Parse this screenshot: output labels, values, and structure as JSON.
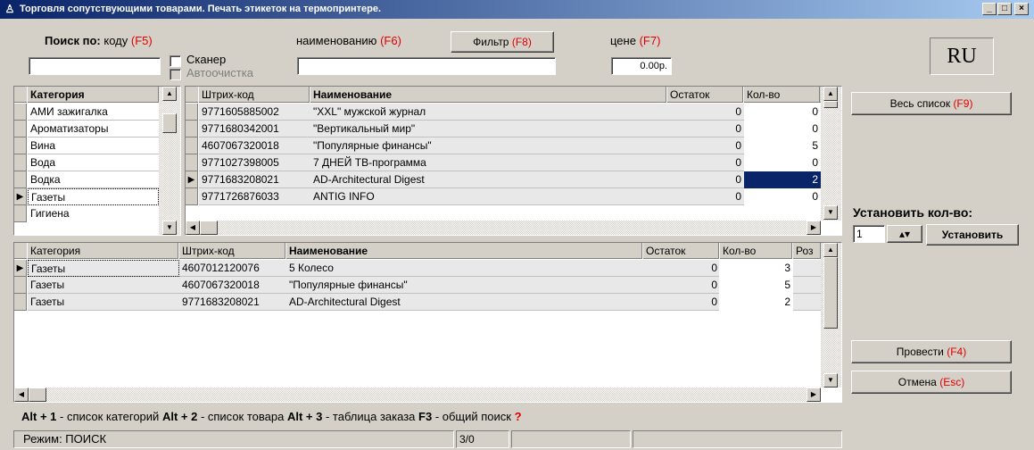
{
  "window": {
    "title": "Торговля сопутствующими товарами. Печать этикеток на термопринтере."
  },
  "search": {
    "label_bold": "Поиск по:",
    "by_code": "коду",
    "f5": "(F5)",
    "scanner_label": "Сканер",
    "autoclean_label": "Автоочистка",
    "by_name": "наименованию",
    "f6": "(F6)",
    "filter_button": "Фильтр",
    "f8": "(F8)",
    "by_price": "цене",
    "f7": "(F7)",
    "price_value": "0.00р.",
    "code_value": "",
    "name_value": ""
  },
  "lang": "RU",
  "categories": {
    "header": "Категория",
    "items": [
      "АМИ зажигалка",
      "Ароматизаторы",
      "Вина",
      "Вода",
      "Водка",
      "Газеты",
      "Гигиена"
    ],
    "selected": "Газеты"
  },
  "products": {
    "headers": {
      "barcode": "Штрих-код",
      "name": "Наименование",
      "stock": "Остаток",
      "qty": "Кол-во"
    },
    "rows": [
      {
        "barcode": "9771605885002",
        "name": "\"XXL\" мужской журнал",
        "stock": "0",
        "qty": "0"
      },
      {
        "barcode": "9771680342001",
        "name": "\"Вертикальный мир\"",
        "stock": "0",
        "qty": "0"
      },
      {
        "barcode": "4607067320018",
        "name": "\"Популярные финансы\"",
        "stock": "0",
        "qty": "5"
      },
      {
        "barcode": "9771027398005",
        "name": "7 ДНЕЙ ТВ-программа",
        "stock": "0",
        "qty": "0"
      },
      {
        "barcode": "9771683208021",
        "name": "AD-Architectural Digest",
        "stock": "0",
        "qty": "2"
      },
      {
        "barcode": "9771726876033",
        "name": "ANTIG INFO",
        "stock": "0",
        "qty": "0"
      }
    ]
  },
  "order": {
    "headers": {
      "category": "Категория",
      "barcode": "Штрих-код",
      "name": "Наименование",
      "stock": "Остаток",
      "qty": "Кол-во",
      "pos": "Роз"
    },
    "rows": [
      {
        "category": "Газеты",
        "barcode": "4607012120076",
        "name": "5 Колесо",
        "stock": "0",
        "qty": "3"
      },
      {
        "category": "Газеты",
        "barcode": "4607067320018",
        "name": "\"Популярные финансы\"",
        "stock": "0",
        "qty": "5"
      },
      {
        "category": "Газеты",
        "barcode": "9771683208021",
        "name": "AD-Architectural Digest",
        "stock": "0",
        "qty": "2"
      }
    ]
  },
  "right_panel": {
    "full_list_button": "Весь список",
    "f9": "(F9)",
    "set_qty_label": "Установить кол-во:",
    "qty_value": "1",
    "set_button": "Установить",
    "post_button": "Провести",
    "f4": "(F4)",
    "cancel_button": "Отмена",
    "esc": "(Esc)"
  },
  "hints": {
    "k1": "Alt + 1",
    "t1": "- список категорий",
    "k2": "Alt + 2",
    "t2": "- список товара",
    "k3": "Alt + 3",
    "t3": "- таблица заказа",
    "k4": "F3",
    "t4": "- общий поиск",
    "q": "?"
  },
  "status": {
    "mode": "Режим: ПОИСК",
    "count": "3/0"
  }
}
